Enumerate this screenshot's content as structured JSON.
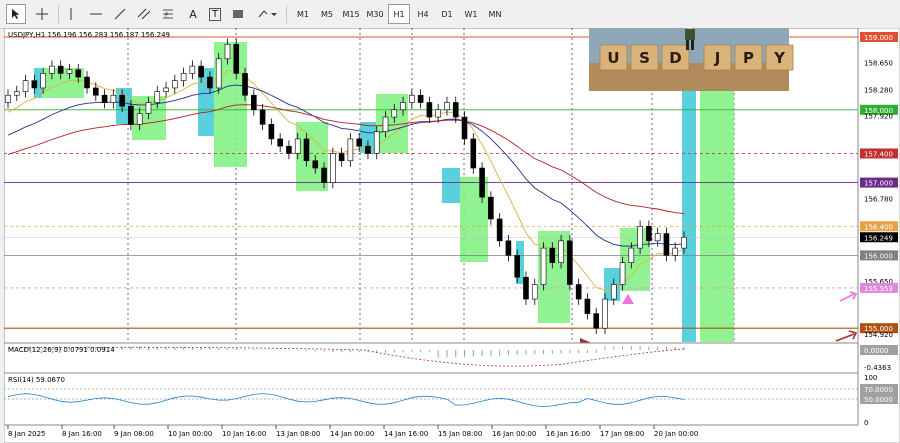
{
  "toolbar": {
    "tools": [
      "cursor-icon",
      "crosshair-icon",
      "vertical-line-icon",
      "horizontal-line-icon",
      "trend-line-icon",
      "channel-icon",
      "fibonacci-icon",
      "text-icon",
      "label-icon",
      "shape-icon",
      "more-shapes-icon"
    ],
    "text_tool_label": "A",
    "label_tool_label": "T",
    "timeframes": [
      "M1",
      "M5",
      "M15",
      "M30",
      "H1",
      "H4",
      "D1",
      "W1",
      "MN"
    ],
    "active_timeframe": "H1"
  },
  "chart": {
    "header": "USDJPY,H1  156.196 156.283 156.187 156.249",
    "price_labels": [
      "159.000",
      "158.650",
      "158.280",
      "158.000",
      "157.920",
      "157.400",
      "157.000",
      "156.780",
      "156.400",
      "156.249",
      "156.000",
      "155.650",
      "155.553",
      "155.000",
      "154.920"
    ],
    "time_labels": [
      "8 Jan 2025",
      "8 Jan 16:00",
      "9 Jan 08:00",
      "10 Jan 00:00",
      "10 Jan 16:00",
      "13 Jan 08:00",
      "14 Jan 00:00",
      "14 Jan 16:00",
      "15 Jan 08:00",
      "16 Jan 00:00",
      "16 Jan 16:00",
      "17 Jan 08:00",
      "20 Jan 00:00"
    ],
    "levels": {
      "resistance_top": 159.0,
      "green_line": 158.0,
      "red_dashed": 157.4,
      "purple_line": 157.0,
      "orange_dashed": 156.4,
      "current": 156.249,
      "gray_line": 156.0,
      "pink_dashed": 155.553,
      "support": 155.0,
      "colors": {
        "resistance": "#e05030",
        "green": "#2fae2f",
        "red": "#c03030",
        "purple": "#6a2c8a",
        "orange": "#e8a040",
        "current_bg": "#000000",
        "gray": "#808080",
        "pink": "#e088e0",
        "support": "#b05010"
      }
    },
    "indicator_colors": {
      "ma_fast": "#e0b040",
      "ma_mid": "#2a2a8a",
      "ma_slow": "#b02020",
      "green_zone": "#7ef07e",
      "cyan_zone": "#3cc8d6"
    }
  },
  "macd": {
    "label": "MACD(12,26,9) 0.0791 0.0914",
    "labels": [
      "0.0000",
      "-0.4363"
    ]
  },
  "rsi": {
    "label": "RSI(14) 59.0670",
    "labels": [
      "100",
      "70.0000",
      "50.0000",
      "0"
    ]
  },
  "thumbnail": {
    "letters": [
      "U",
      "S",
      "D",
      "J",
      "P",
      "Y"
    ]
  },
  "chart_data": {
    "type": "candlestick",
    "symbol": "USDJPY",
    "timeframe": "H1",
    "ylim": [
      154.92,
      159.0
    ],
    "candles_close": [
      158.2,
      158.25,
      158.4,
      158.3,
      158.5,
      158.6,
      158.5,
      158.55,
      158.45,
      158.3,
      158.2,
      158.1,
      158.2,
      158.05,
      157.8,
      157.95,
      158.1,
      158.25,
      158.3,
      158.4,
      158.5,
      158.6,
      158.45,
      158.3,
      158.7,
      158.9,
      158.5,
      158.2,
      158.0,
      157.8,
      157.6,
      157.5,
      157.4,
      157.6,
      157.3,
      157.2,
      157.0,
      157.4,
      157.3,
      157.6,
      157.5,
      157.4,
      157.7,
      157.9,
      158.0,
      158.1,
      158.2,
      158.1,
      157.9,
      158.0,
      158.1,
      157.9,
      157.6,
      157.2,
      156.8,
      156.5,
      156.2,
      156.0,
      155.7,
      155.4,
      155.6,
      156.1,
      155.9,
      156.2,
      155.6,
      155.4,
      155.2,
      155.0,
      155.4,
      155.6,
      155.9,
      156.1,
      156.4,
      156.2,
      156.3,
      156.0,
      156.1,
      156.249
    ]
  }
}
